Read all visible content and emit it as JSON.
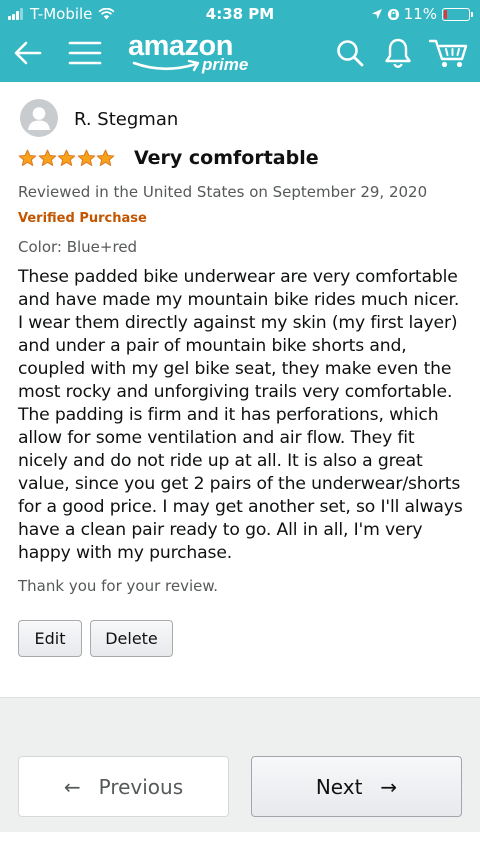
{
  "status_bar": {
    "carrier": "T-Mobile",
    "time": "4:38 PM",
    "battery_pct": "11%",
    "battery_level": 0.11,
    "battery_color": "#e2373a"
  },
  "app_bar": {
    "background": "#34b7c3",
    "brand_main": "amazon",
    "brand_sub": "prime",
    "icons": [
      "back-arrow-icon",
      "hamburger-menu-icon",
      "search-icon",
      "notifications-bell-icon",
      "cart-icon"
    ]
  },
  "review": {
    "reviewer_name": "R. Stegman",
    "rating": 5,
    "rating_max": 5,
    "title": "Very comfortable",
    "meta": "Reviewed in the United States on September 29, 2020",
    "verified": "Verified Purchase",
    "variant": "Color: Blue+red",
    "body": "These padded bike underwear are very comfortable and have made my mountain bike rides much nicer.  I wear them directly against my skin (my first layer) and under a pair of mountain bike shorts and, coupled with my gel bike seat, they make even the most rocky and unforgiving trails very comfortable. The padding is firm and it has perforations, which allow for some ventilation and air flow.  They fit nicely and do not ride up at all.  It is also a great value, since you get 2 pairs of the underwear/shorts for a good price.  I may get another set, so I'll always have a clean pair ready to go.  All in all, I'm very happy with my purchase.",
    "thanks": "Thank you for your review.",
    "star_color": "#f7a21b"
  },
  "actions": {
    "edit_label": "Edit",
    "delete_label": "Delete"
  },
  "pagination": {
    "previous_label": "Previous",
    "previous_arrow": "←",
    "next_label": "Next",
    "next_arrow": "→"
  }
}
